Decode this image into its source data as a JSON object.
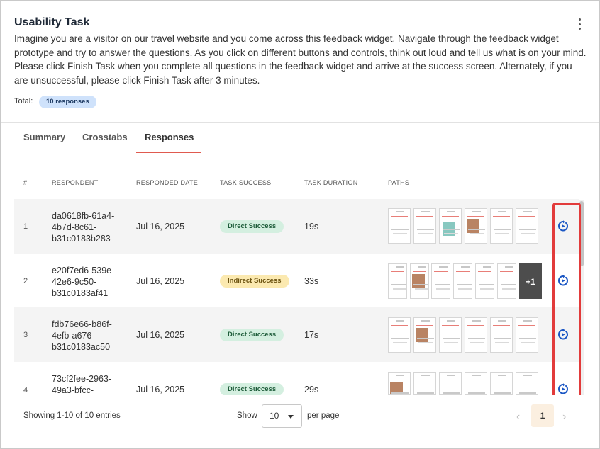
{
  "header": {
    "title": "Usability Task",
    "description": "Imagine you are a visitor on our travel website and you come across this feedback widget. Navigate through the feedback widget prototype and try to answer the questions. As you click on different buttons and controls, think out loud and tell us what is on your mind. Please click Finish Task when you complete all questions in the feedback widget and arrive at the success screen. Alternately, if you are unsuccessful, please click Finish Task after 3 minutes.",
    "total_label": "Total:",
    "total_badge": "10 responses",
    "menu_icon": "kebab-menu-icon"
  },
  "tabs": [
    {
      "label": "Summary",
      "active": false
    },
    {
      "label": "Crosstabs",
      "active": false
    },
    {
      "label": "Responses",
      "active": true
    }
  ],
  "table": {
    "columns": [
      "#",
      "RESPONDENT",
      "RESPONDED DATE",
      "TASK SUCCESS",
      "TASK DURATION",
      "PATHS"
    ],
    "rows": [
      {
        "num": "1",
        "respondent": "da0618fb-61a4-4b7d-8c61-b31c0183b283",
        "date": "Jul 16, 2025",
        "success": "Direct Success",
        "duration": "19s"
      },
      {
        "num": "2",
        "respondent": "e20f7ed6-539e-42e6-9c50-b31c0183af41",
        "date": "Jul 16, 2025",
        "success": "Indirect Success",
        "duration": "33s",
        "more": "+1"
      },
      {
        "num": "3",
        "respondent": "fdb76e66-b86f-4efb-a676-b31c0183ac50",
        "date": "Jul 16, 2025",
        "success": "Direct Success",
        "duration": "17s"
      },
      {
        "num": "4",
        "respondent": "73cf2fee-2963-49a3-bfcc-",
        "date": "Jul 16, 2025",
        "success": "Direct Success",
        "duration": "29s"
      }
    ],
    "replay_icon": "replay-icon"
  },
  "footer": {
    "showing": "Showing 1-10 of 10 entries",
    "show_label": "Show",
    "per_page_value": "10",
    "per_page_label": "per page",
    "current_page": "1"
  },
  "colors": {
    "accent_underline": "#e05a4f",
    "highlight_border": "#e23b3b",
    "direct_bg": "#d4efe0",
    "indirect_bg": "#fbe9b0",
    "badge_bg": "#cfe2fb",
    "replay_icon": "#1a56c4"
  }
}
